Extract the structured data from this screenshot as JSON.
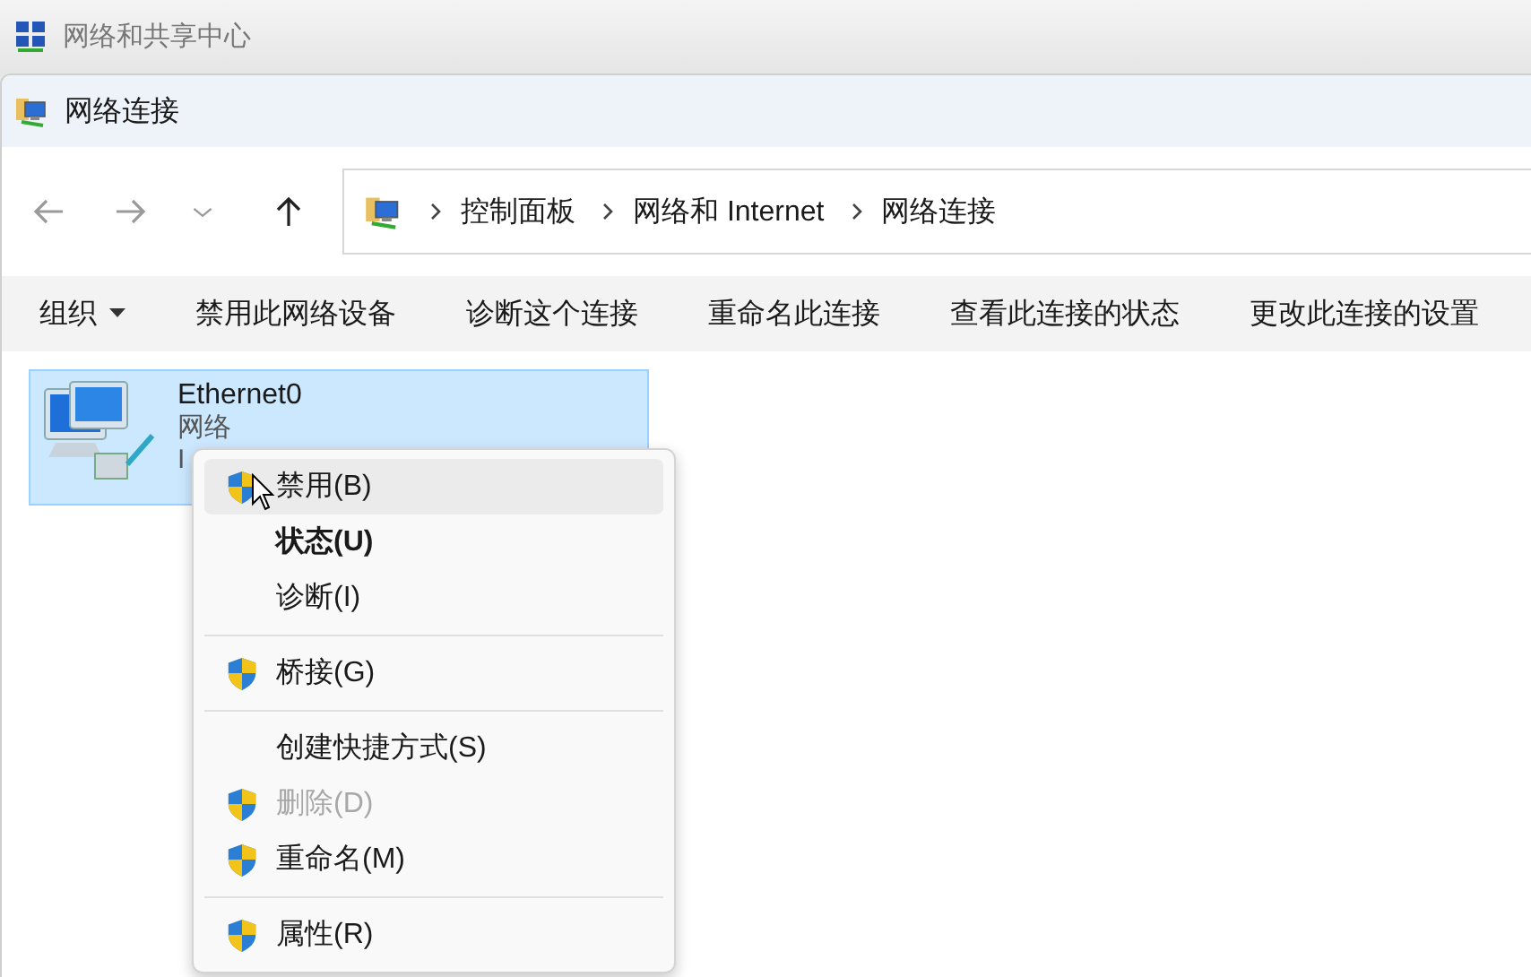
{
  "background_window": {
    "title": "网络和共享中心"
  },
  "window": {
    "title": "网络连接"
  },
  "nav": [
    {
      "kind": "back",
      "disabled": true
    },
    {
      "kind": "forward",
      "disabled": true
    },
    {
      "kind": "recent",
      "disabled": true
    },
    {
      "kind": "up",
      "disabled": false
    }
  ],
  "breadcrumb": [
    "控制面板",
    "网络和 Internet",
    "网络连接"
  ],
  "toolbar": [
    {
      "label": "组织",
      "dropdown": true
    },
    {
      "label": "禁用此网络设备",
      "dropdown": false
    },
    {
      "label": "诊断这个连接",
      "dropdown": false
    },
    {
      "label": "重命名此连接",
      "dropdown": false
    },
    {
      "label": "查看此连接的状态",
      "dropdown": false
    },
    {
      "label": "更改此连接的设置",
      "dropdown": false
    }
  ],
  "connections": [
    {
      "name": "Ethernet0",
      "network": "网络",
      "status": "I",
      "selected": true
    }
  ],
  "context_menu": {
    "items": [
      {
        "kind": "item",
        "label": "禁用(B)",
        "shield": true,
        "bold": false,
        "disabled": false,
        "selected": true
      },
      {
        "kind": "item",
        "label": "状态(U)",
        "shield": false,
        "bold": true,
        "disabled": false,
        "selected": false
      },
      {
        "kind": "item",
        "label": "诊断(I)",
        "shield": false,
        "bold": false,
        "disabled": false,
        "selected": false
      },
      {
        "kind": "separator"
      },
      {
        "kind": "item",
        "label": "桥接(G)",
        "shield": true,
        "bold": false,
        "disabled": false,
        "selected": false
      },
      {
        "kind": "separator"
      },
      {
        "kind": "item",
        "label": "创建快捷方式(S)",
        "shield": false,
        "bold": false,
        "disabled": false,
        "selected": false
      },
      {
        "kind": "item",
        "label": "删除(D)",
        "shield": true,
        "bold": false,
        "disabled": true,
        "selected": false
      },
      {
        "kind": "item",
        "label": "重命名(M)",
        "shield": true,
        "bold": false,
        "disabled": false,
        "selected": false
      },
      {
        "kind": "separator"
      },
      {
        "kind": "item",
        "label": "属性(R)",
        "shield": true,
        "bold": false,
        "disabled": false,
        "selected": false
      }
    ]
  }
}
